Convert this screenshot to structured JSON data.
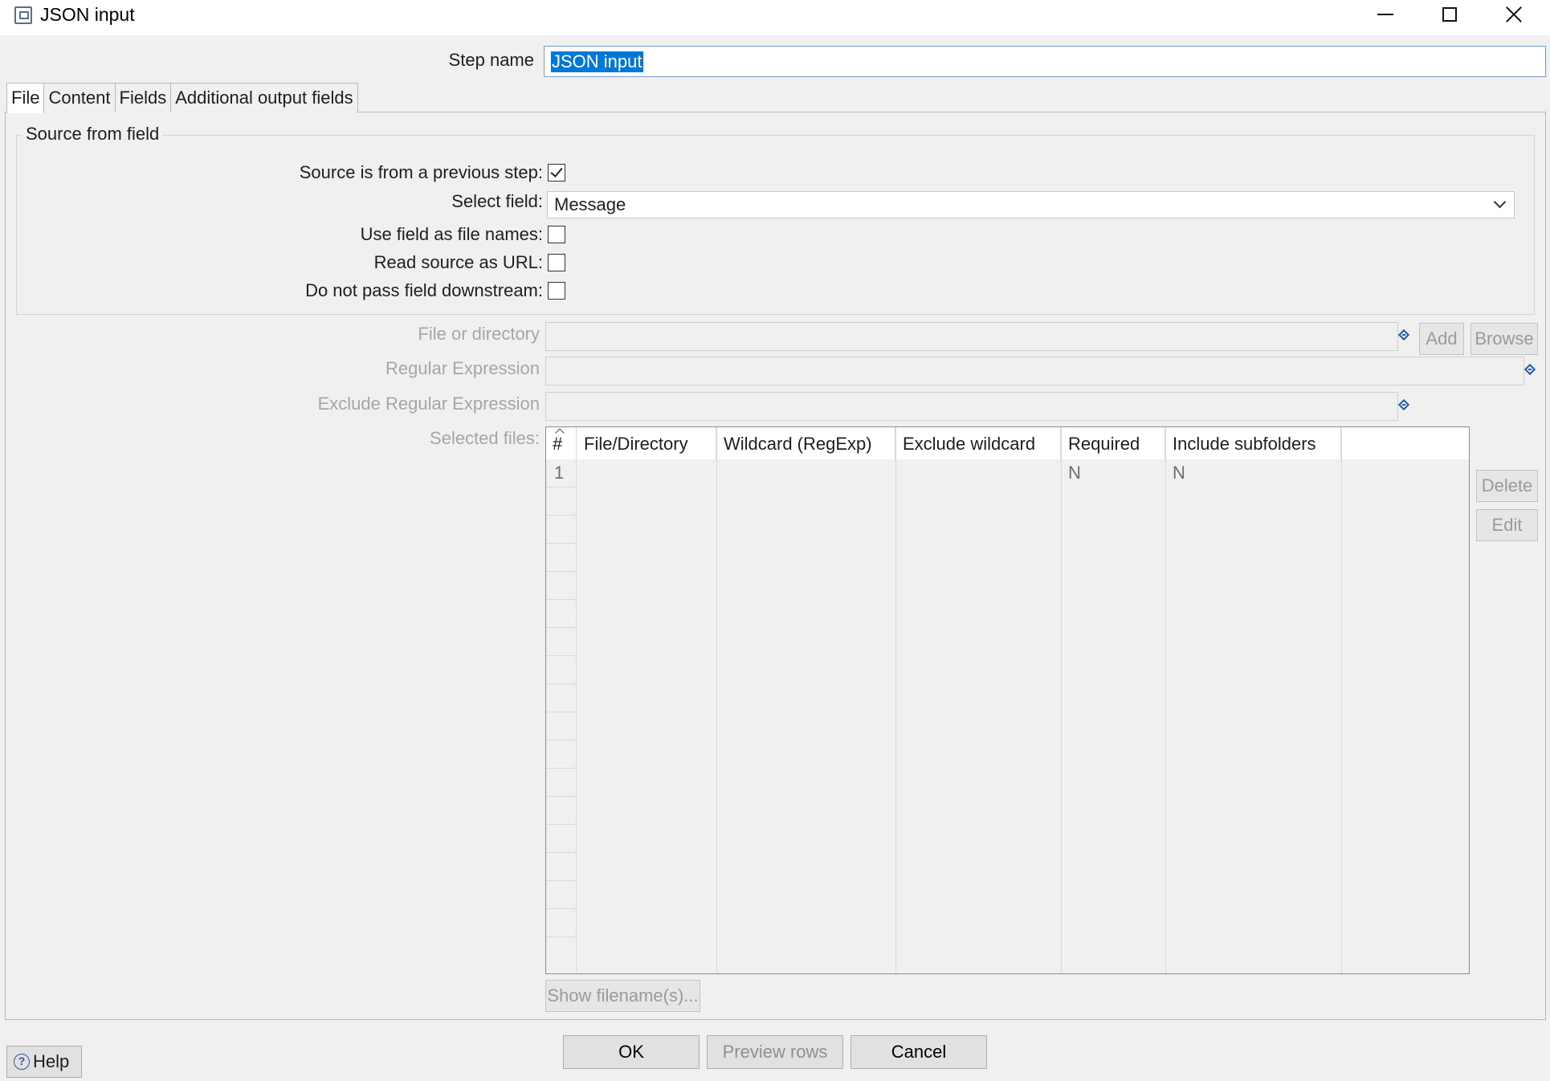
{
  "window": {
    "title": "JSON input",
    "icon": "window-app-icon",
    "controls": [
      "minimize-icon",
      "maximize-icon",
      "close-icon"
    ]
  },
  "step": {
    "label": "Step name",
    "value": "JSON input"
  },
  "tabs": [
    {
      "label": "File",
      "active": true
    },
    {
      "label": "Content",
      "active": false
    },
    {
      "label": "Fields",
      "active": false
    },
    {
      "label": "Additional output fields",
      "active": false
    }
  ],
  "source_group": {
    "legend": "Source from field",
    "source_prev_step": {
      "label": "Source is from a previous step:",
      "checked": true
    },
    "select_field": {
      "label": "Select field:",
      "value": "Message"
    },
    "use_field_as_filenames": {
      "label": "Use field as file names:",
      "checked": false
    },
    "read_source_as_url": {
      "label": "Read source as URL:",
      "checked": false
    },
    "do_not_pass_downstream": {
      "label": "Do not pass field downstream:",
      "checked": false
    }
  },
  "file_section": {
    "file_or_dir_label": "File or directory",
    "regex_label": "Regular Expression",
    "exclude_regex_label": "Exclude Regular Expression",
    "selected_files_label": "Selected files:",
    "add_label": "Add",
    "browse_label": "Browse",
    "delete_label": "Delete",
    "edit_label": "Edit",
    "show_filenames_label": "Show filename(s)..."
  },
  "files_table": {
    "columns": [
      "#",
      "File/Directory",
      "Wildcard (RegExp)",
      "Exclude wildcard",
      "Required",
      "Include subfolders"
    ],
    "rows": [
      {
        "num": "1",
        "file": "",
        "wildcard": "",
        "exclude": "",
        "required": "N",
        "subfolders": "N"
      }
    ]
  },
  "footer": {
    "help_label": "Help",
    "ok_label": "OK",
    "preview_label": "Preview rows",
    "cancel_label": "Cancel"
  },
  "colors": {
    "selection": "#0078d7",
    "background": "#f0f0f0",
    "disabled_text": "#a6a6a6"
  }
}
